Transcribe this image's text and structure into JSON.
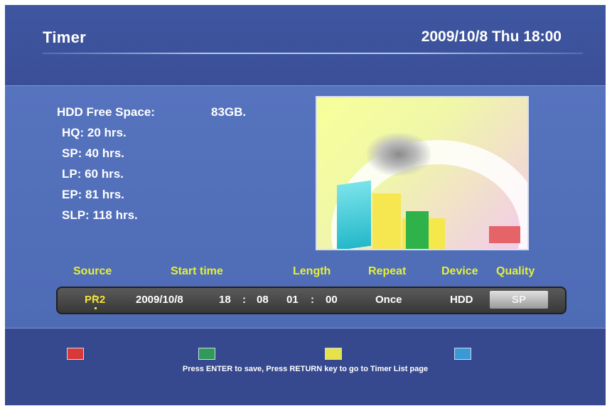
{
  "header": {
    "title": "Timer",
    "datetime": "2009/10/8 Thu 18:00"
  },
  "space": {
    "free_label": "HDD Free Space:",
    "free_value": "83GB.",
    "modes": [
      {
        "label": "HQ: 20 hrs."
      },
      {
        "label": "SP: 40 hrs."
      },
      {
        "label": "LP: 60 hrs."
      },
      {
        "label": "EP: 81 hrs."
      },
      {
        "label": "SLP: 118 hrs."
      }
    ]
  },
  "columns": {
    "source": "Source",
    "start_time": "Start time",
    "length": "Length",
    "repeat": "Repeat",
    "device": "Device",
    "quality": "Quality"
  },
  "timer": {
    "source": "PR2",
    "date": "2009/10/8",
    "start_hour": "18",
    "start_minute": "08",
    "length_hour": "01",
    "length_minute": "00",
    "separator": ":",
    "repeat": "Once",
    "device": "HDD",
    "quality": "SP"
  },
  "footer": {
    "keys": [
      {
        "name": "red-key",
        "color": "#d83a3a"
      },
      {
        "name": "green-key",
        "color": "#2f9a5a"
      },
      {
        "name": "yellow-key",
        "color": "#e6e24a"
      },
      {
        "name": "blue-key",
        "color": "#3a9ad6"
      }
    ],
    "instruction": "Press ENTER to save, Press RETURN key to go to Timer List page"
  }
}
